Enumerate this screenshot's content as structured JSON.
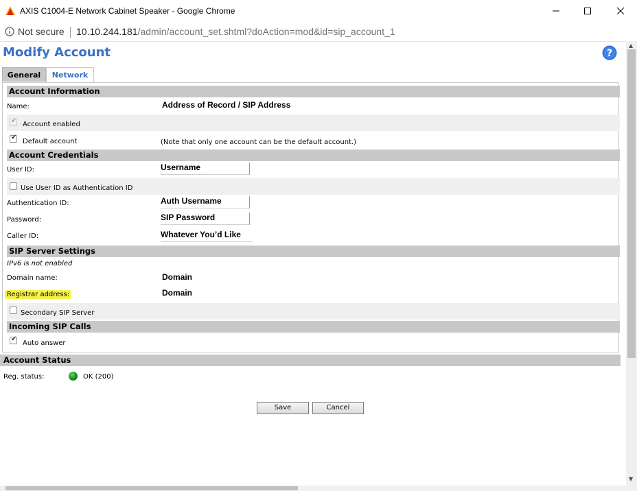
{
  "window": {
    "title": "AXIS C1004-E Network Cabinet Speaker - Google Chrome",
    "icon": "axis-logo-icon"
  },
  "address_bar": {
    "security_label": "Not secure",
    "url_host": "10.10.244.181",
    "url_path": "/admin/account_set.shtml?doAction=mod&id=sip_account_1"
  },
  "page": {
    "title": "Modify Account",
    "help_icon": "help-question-icon"
  },
  "tabs": [
    {
      "label": "General",
      "active": false
    },
    {
      "label": "Network",
      "active": true
    }
  ],
  "account_information": {
    "heading": "Account Information",
    "name_label": "Name:",
    "name_value": "Address of Record / SIP Address",
    "enabled_label": "Account enabled",
    "enabled_checked": true,
    "default_label": "Default account",
    "default_checked": true,
    "default_note": "(Note that only one account can be the default account.)"
  },
  "account_credentials": {
    "heading": "Account Credentials",
    "user_id_label": "User ID:",
    "user_id_value": "Username",
    "use_user_id_label": "Use User ID as Authentication ID",
    "use_user_id_checked": false,
    "auth_id_label": "Authentication ID:",
    "auth_id_value": "Auth Username",
    "password_label": "Password:",
    "password_value": "SIP Password",
    "caller_id_label": "Caller ID:",
    "caller_id_value": "Whatever You’d Like"
  },
  "sip_server_settings": {
    "heading": "SIP Server Settings",
    "ipv6_note": "IPv6 is not enabled",
    "domain_label": "Domain name:",
    "domain_value": "Domain",
    "registrar_label": "Registrar address:",
    "registrar_value": "Domain",
    "secondary_label": "Secondary SIP Server",
    "secondary_checked": false
  },
  "incoming_sip_calls": {
    "heading": "Incoming SIP Calls",
    "auto_answer_label": "Auto answer",
    "auto_answer_checked": true
  },
  "account_status": {
    "heading": "Account Status",
    "reg_label": "Reg. status:",
    "reg_value": "OK (200)",
    "status_color": "#1f9a1f"
  },
  "buttons": {
    "save": "Save",
    "cancel": "Cancel"
  },
  "colors": {
    "title_blue": "#3a6fc4",
    "section_gray": "#c8c8c8",
    "highlight_yellow": "#f5f34a"
  }
}
